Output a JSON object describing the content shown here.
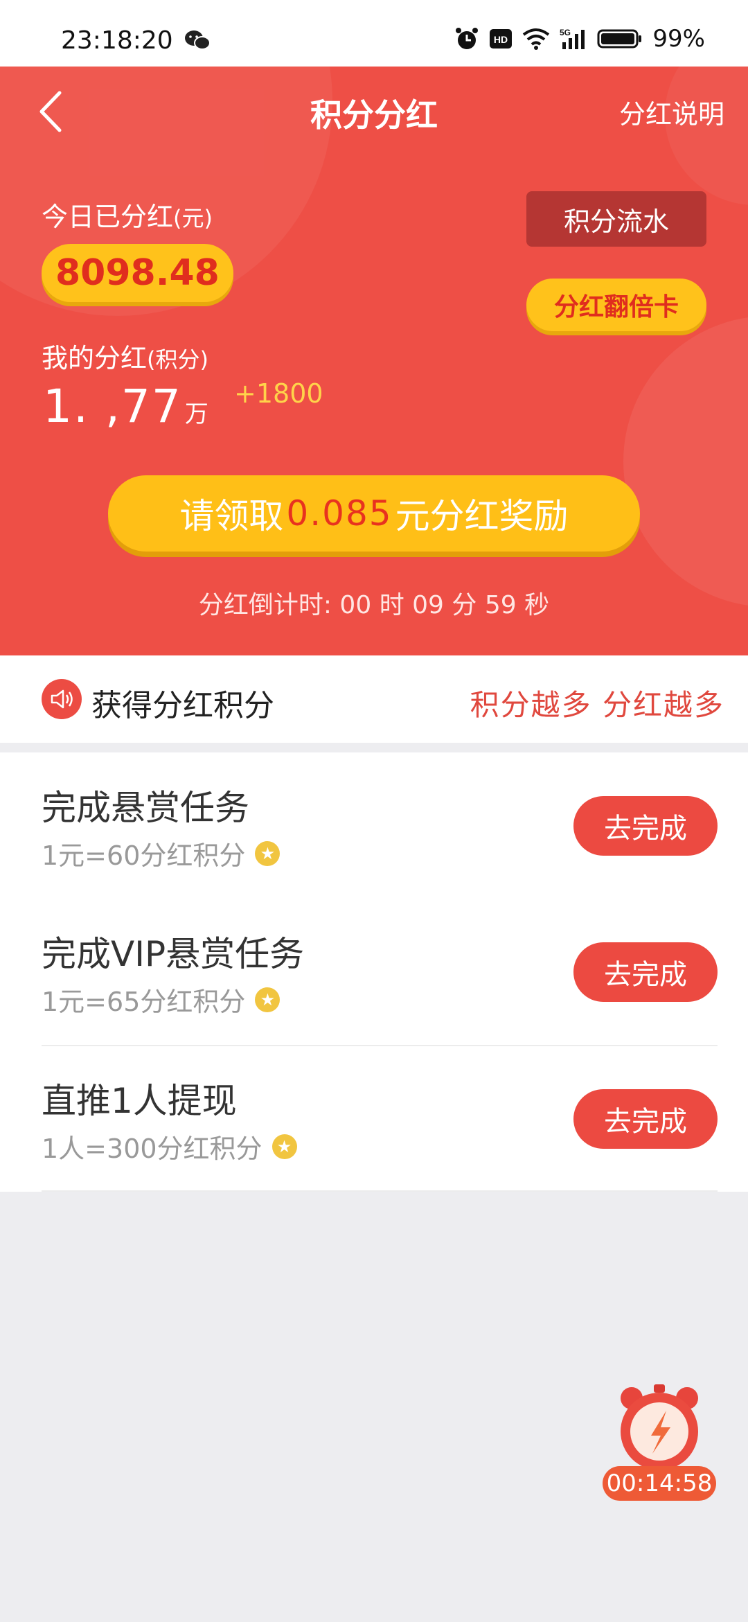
{
  "status_bar": {
    "time": "23:18:20",
    "battery": "99%",
    "icons": [
      "wechat-icon",
      "alarm-icon",
      "hd-icon",
      "wifi-icon",
      "5g-signal-icon",
      "battery-icon"
    ]
  },
  "nav": {
    "title": "积分分红",
    "right_link": "分红说明"
  },
  "hero": {
    "today_label": "今日已分红",
    "today_unit": "(元)",
    "today_value": "8098.48",
    "flow_button": "积分流水",
    "double_card_button": "分红翻倍卡",
    "my_label": "我的分红",
    "my_unit_label": "(积分)",
    "my_value": "1.  ,77",
    "my_value_unit": "万",
    "my_plus": "+1800",
    "claim_prefix": "请领取",
    "claim_amount": "0.085",
    "claim_suffix": "元分红奖励",
    "countdown_label": "分红倒计时:",
    "countdown_h": "00",
    "countdown_h_unit": "时",
    "countdown_m": "09",
    "countdown_m_unit": "分",
    "countdown_s": "59",
    "countdown_s_unit": "秒"
  },
  "earn": {
    "title": "获得分红积分",
    "slogan": "积分越多 分红越多"
  },
  "tasks": [
    {
      "title": "完成悬赏任务",
      "rate": "1元=60分红积分",
      "button": "去完成"
    },
    {
      "title": "完成VIP悬赏任务",
      "rate": "1元=65分红积分",
      "button": "去完成"
    },
    {
      "title": "直推1人提现",
      "rate": "1人=300分红积分",
      "button": "去完成"
    }
  ],
  "float_timer": {
    "time": "00:14:58"
  },
  "colors": {
    "hero_red": "#ee4f46",
    "gold": "#ffc21b",
    "button_red": "#ec4a41"
  }
}
